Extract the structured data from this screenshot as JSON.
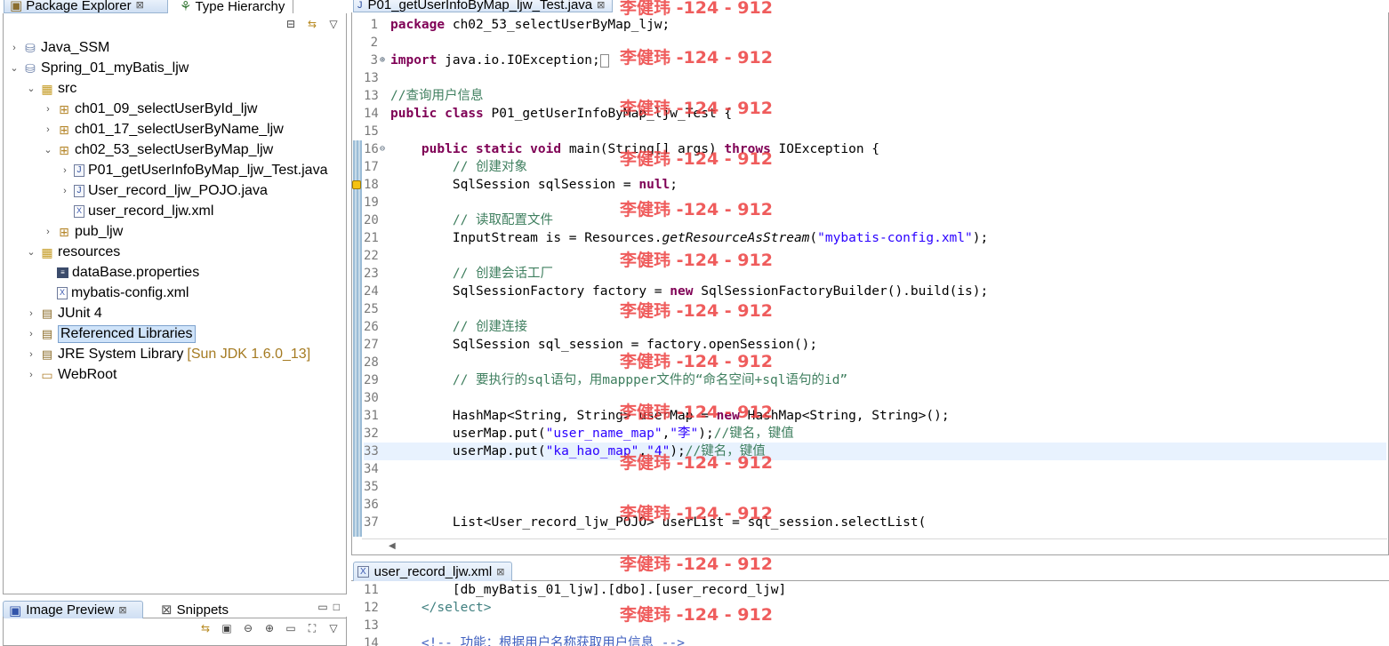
{
  "package_explorer": {
    "tabs": [
      {
        "label": "Package Explorer",
        "close": "⊠"
      },
      {
        "label": "Type Hierarchy"
      }
    ],
    "toolbar": {
      "collapse": "⊟",
      "link": "⇆",
      "menu": "▽"
    },
    "tree": [
      {
        "label": "Java_SSM",
        "twisty": "›",
        "icon": "project-icon"
      },
      {
        "label": "Spring_01_myBatis_ljw",
        "twisty": "⌄",
        "icon": "project-icon"
      },
      {
        "label": "src",
        "twisty": "⌄",
        "icon": "source-folder-icon"
      },
      {
        "label": "ch01_09_selectUserById_ljw",
        "twisty": "›",
        "icon": "package-icon"
      },
      {
        "label": "ch01_17_selectUserByName_ljw",
        "twisty": "›",
        "icon": "package-icon"
      },
      {
        "label": "ch02_53_selectUserByMap_ljw",
        "twisty": "⌄",
        "icon": "package-icon"
      },
      {
        "label": "P01_getUserInfoByMap_ljw_Test.java",
        "twisty": "›",
        "icon": "java-file-icon"
      },
      {
        "label": "User_record_ljw_POJO.java",
        "twisty": "›",
        "icon": "java-file-icon"
      },
      {
        "label": "user_record_ljw.xml",
        "twisty": "",
        "icon": "xml-file-icon"
      },
      {
        "label": "pub_ljw",
        "twisty": "›",
        "icon": "package-icon"
      },
      {
        "label": "resources",
        "twisty": "⌄",
        "icon": "source-folder-icon"
      },
      {
        "label": "dataBase.properties",
        "twisty": "",
        "icon": "properties-file-icon"
      },
      {
        "label": "mybatis-config.xml",
        "twisty": "",
        "icon": "xml-file-icon"
      },
      {
        "label": "JUnit 4",
        "twisty": "›",
        "icon": "library-icon"
      },
      {
        "label": "Referenced Libraries",
        "twisty": "›",
        "icon": "library-icon"
      },
      {
        "label": "JRE System Library",
        "twisty": "›",
        "icon": "library-icon",
        "decoration": "[Sun JDK 1.6.0_13]"
      },
      {
        "label": "WebRoot",
        "twisty": "›",
        "icon": "folder-icon"
      }
    ]
  },
  "image_preview": {
    "tabs": [
      {
        "label": "Image Preview",
        "close": "⊠"
      },
      {
        "label": "Snippets"
      }
    ],
    "window_controls": {
      "minimize": "▭",
      "maximize": "□"
    }
  },
  "editor": {
    "tab": {
      "label": "P01_getUserInfoByMap_ljw_Test.java",
      "close": "⊠"
    },
    "lines": [
      {
        "n": "1",
        "t": "package ch02_53_selectUserByMap_ljw;"
      },
      {
        "n": "2",
        "t": ""
      },
      {
        "n": "3",
        "t": "import java.io.IOException;"
      },
      {
        "n": "13",
        "t": ""
      },
      {
        "n": "13",
        "t": "//查询用户信息"
      },
      {
        "n": "14",
        "t": "public class P01_getUserInfoByMap_ljw_Test {"
      },
      {
        "n": "15",
        "t": ""
      },
      {
        "n": "16",
        "t": "    public static void main(String[] args) throws IOException {"
      },
      {
        "n": "17",
        "t": "        // 创建对象"
      },
      {
        "n": "18",
        "t": "        SqlSession sqlSession = null;"
      },
      {
        "n": "19",
        "t": ""
      },
      {
        "n": "20",
        "t": "        // 读取配置文件"
      },
      {
        "n": "21",
        "t": "        InputStream is = Resources.getResourceAsStream(\"mybatis-config.xml\");"
      },
      {
        "n": "22",
        "t": ""
      },
      {
        "n": "23",
        "t": "        // 创建会话工厂"
      },
      {
        "n": "24",
        "t": "        SqlSessionFactory factory = new SqlSessionFactoryBuilder().build(is);"
      },
      {
        "n": "25",
        "t": ""
      },
      {
        "n": "26",
        "t": "        // 创建连接"
      },
      {
        "n": "27",
        "t": "        SqlSession sql_session = factory.openSession();"
      },
      {
        "n": "28",
        "t": ""
      },
      {
        "n": "29",
        "t": "        // 要执行的sql语句，用mappper文件的“命名空间+sql语句的id”"
      },
      {
        "n": "30",
        "t": ""
      },
      {
        "n": "31",
        "t": "        HashMap<String, String> userMap = new HashMap<String, String>();"
      },
      {
        "n": "32",
        "t": "        userMap.put(\"user_name_map\",\"李\");//键名，键值"
      },
      {
        "n": "33",
        "t": "        userMap.put(\"ka_hao_map\",\"4\");//键名，键值"
      },
      {
        "n": "34",
        "t": ""
      },
      {
        "n": "35",
        "t": ""
      },
      {
        "n": "36",
        "t": ""
      },
      {
        "n": "37",
        "t": "        List<User_record_ljw_POJO> userList = sql_session.selectList("
      }
    ],
    "current_line": "33"
  },
  "xml_editor": {
    "tab": {
      "label": "user_record_ljw.xml",
      "close": "⊠"
    },
    "lines": [
      {
        "n": "11",
        "t": "        [db_myBatis_01_ljw].[dbo].[user_record_ljw]"
      },
      {
        "n": "12",
        "t": "    </select>"
      },
      {
        "n": "13",
        "t": ""
      },
      {
        "n": "14",
        "t": "    <!-- 功能：根据用户名称获取用户信息 -->"
      }
    ]
  },
  "watermark": {
    "text": "李健玮 -124 - 912",
    "color": "#ec4040"
  }
}
